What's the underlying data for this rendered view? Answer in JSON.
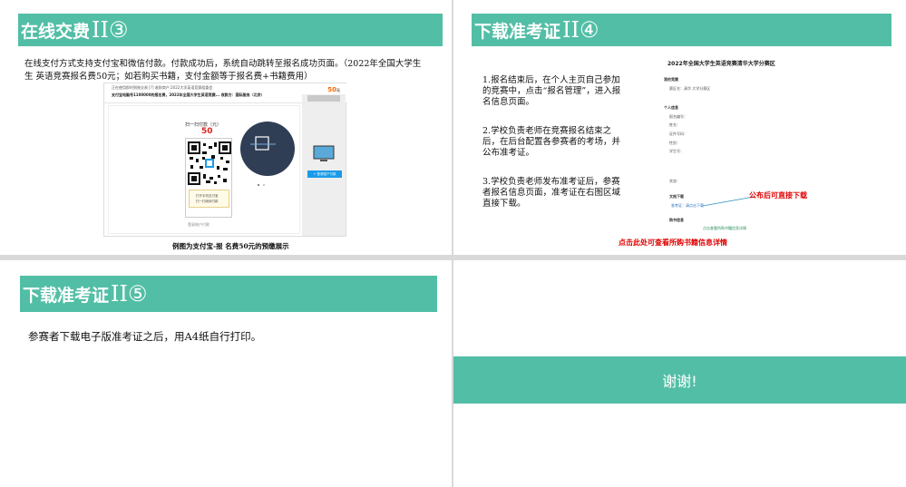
{
  "slide1": {
    "banner_title": "在线交费",
    "banner_num": "II③",
    "desc_line1": "在线支付方式支持支付宝和微信付款。付款成功后，系统自动跳转至报名成功页面。（2022年全国大学生",
    "desc_line2": "生 英语竞赛报名费50元；如若购买书籍，支付金额等于报名费+书籍费用）",
    "caption": "例图为支付宝-报 名费50元的预缴展示",
    "mock": {
      "amount": "50",
      "amount_right": "50",
      "amount_unit": "元",
      "scan_label": "扫一扫付款（元）",
      "hint1": "打开手机支付宝",
      "hint2": "扫一扫继续付款",
      "pc_link": "登录账户付款",
      "pc_button": "+ 登录账户付款",
      "top_line1": "正在使用即时到账交易 [?]     收款商户:2022大学英语竞赛组委会",
      "top_line2": "支付宝电脑号1100000的报名费，2022年全国大学生英语竞赛...    收款方：国际服务（北京）"
    }
  },
  "slide2": {
    "banner_title": "下载准考证",
    "banner_num": "II④",
    "step1": "1.报名结束后，在个人主页自己参加的竞赛中，点击“报名管理”，进入报名信息页面。",
    "step2": "2.学校负责老师在竞赛报名结束之后，在后台配置各参赛者的考场，并公布准考证。",
    "step3": "3.学校负责老师发布准考证后，参赛者报名信息页面，准考证在右图区域直接下载。",
    "mock_title": "2022年全国大学生英语竞赛清华大学分赛区",
    "mock_section1": "我的竞赛",
    "mock_field1": "赛区名：清华 大学分赛区",
    "mock_section2": "个人信息",
    "mock_rows": [
      "报名编号：",
      "姓名：",
      "证件号码：",
      "性别：",
      "学生号："
    ],
    "mock_status": "状态：",
    "mock_section3": "文档下载",
    "mock_download": "准考证：请点击下载",
    "mock_section4": "购书信息",
    "mock_footer_link": "点击查看所购书籍信息详情",
    "annotation": "公布后可直接下载",
    "bottom_note": "点击此处可查看所购书籍信息详情"
  },
  "slide3": {
    "banner_title": "下载准考证",
    "banner_num": "II⑤",
    "body": "参赛者下载电子版准考证之后，用A4纸自行打印。"
  },
  "slide4": {
    "thanks": "谢谢!"
  },
  "colors": {
    "accent": "#52bea5",
    "alert": "#e00000",
    "alipay_blue": "#1a9be8"
  }
}
